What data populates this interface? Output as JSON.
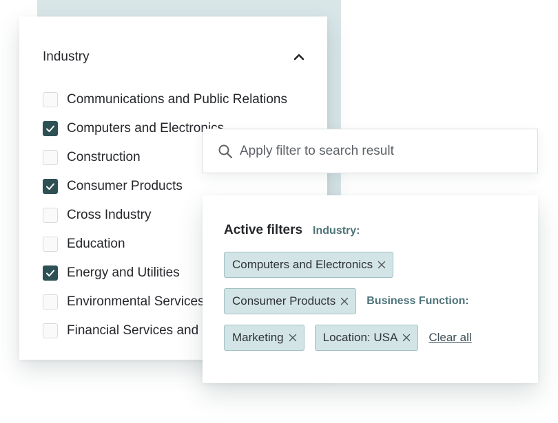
{
  "industry_panel": {
    "title": "Industry",
    "expanded": true,
    "options": [
      {
        "label": "Communications and Public Relations",
        "checked": false
      },
      {
        "label": "Computers and Electronics",
        "checked": true
      },
      {
        "label": "Construction",
        "checked": false
      },
      {
        "label": "Consumer Products",
        "checked": true
      },
      {
        "label": "Cross Industry",
        "checked": false
      },
      {
        "label": "Education",
        "checked": false
      },
      {
        "label": "Energy and Utilities",
        "checked": true
      },
      {
        "label": "Environmental Services",
        "checked": false
      },
      {
        "label": "Financial Services and Insurance",
        "checked": false
      }
    ]
  },
  "search": {
    "placeholder": "Apply filter to search result",
    "value": ""
  },
  "active_filters": {
    "title": "Active filters",
    "industry_label": "Industry:",
    "business_function_label": "Business Function:",
    "chips": {
      "computers": "Computers and Electronics",
      "consumer": "Consumer Products",
      "marketing": "Marketing",
      "location": "Location: USA"
    },
    "clear_all": "Clear all"
  },
  "colors": {
    "accent": "#2d5055",
    "chip_background": "#d3e4e6",
    "chip_border": "#9fc0c4",
    "label_teal": "#4e7479",
    "backdrop": "#d8e6e8"
  },
  "icons": {
    "collapse": "chevron-up-icon",
    "search": "search-icon",
    "remove": "close-icon",
    "check": "check-icon"
  }
}
